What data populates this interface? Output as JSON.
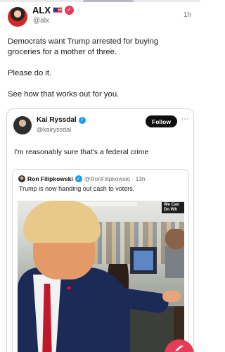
{
  "post": {
    "author_name": "ALX",
    "author_handle": "@alx",
    "timestamp": "1h",
    "paragraphs": [
      "Democrats want Trump arrested for buying groceries for a mother of three.",
      "Please do it.",
      "See how that works out for you."
    ]
  },
  "embedded_post": {
    "author_name": "Kai Ryssdal",
    "author_handle": "@kairyssdal",
    "follow_label": "Follow",
    "more_label": "···",
    "text": "I'm reasonably sure that's a federal crime"
  },
  "quoted_post": {
    "author_name": "Ron Filipkowski",
    "meta": "@RonFilipkowski · 13h",
    "text": "Trump is now handing out cash to voters.",
    "sign_text_line1": "We Can",
    "sign_text_line2": "Do Wh"
  },
  "colors": {
    "accent": "#e63b57",
    "verified_blue": "#1d9bf0",
    "follow_button": "#0f0f0f"
  },
  "icons": {
    "author_badge": "verified-check-icon",
    "compose": "compose-icon",
    "more": "more-icon"
  }
}
